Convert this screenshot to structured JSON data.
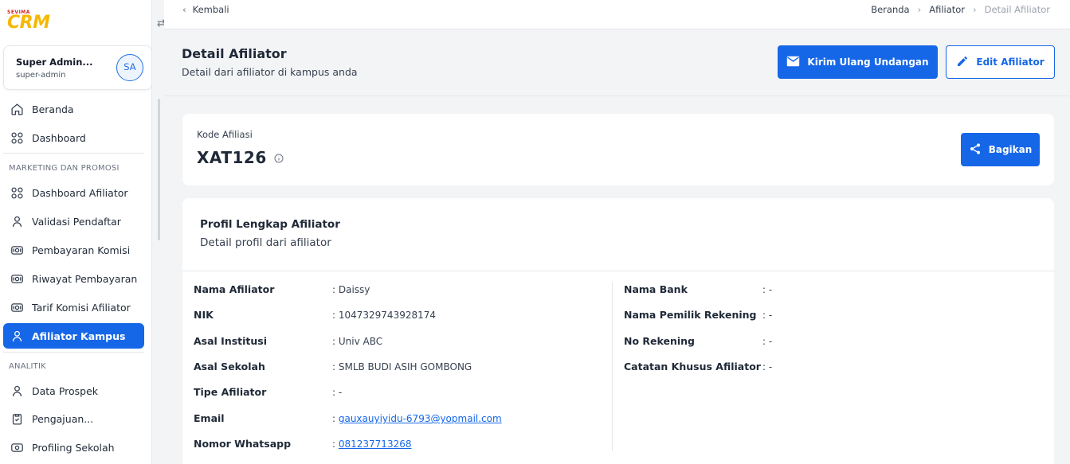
{
  "brand": {
    "top": "SEVIMA",
    "name": "CRM"
  },
  "user": {
    "name": "Super Admin...",
    "role": "super-admin",
    "initials": "SA"
  },
  "nav": {
    "main": [
      {
        "label": "Beranda",
        "icon": "home-icon"
      },
      {
        "label": "Dashboard",
        "icon": "grid-icon"
      }
    ],
    "section1": "MARKETING DAN PROMOSI",
    "marketing": [
      {
        "label": "Dashboard Afiliator",
        "icon": "grid-icon"
      },
      {
        "label": "Validasi Pendaftar",
        "icon": "person-icon"
      },
      {
        "label": "Pembayaran Komisi",
        "icon": "money-icon"
      },
      {
        "label": "Riwayat Pembayaran",
        "icon": "money-icon"
      },
      {
        "label": "Tarif Komisi Afiliator",
        "icon": "money-icon"
      },
      {
        "label": "Afiliator Kampus",
        "icon": "person-icon",
        "active": true
      }
    ],
    "section2": "ANALITIK",
    "analitik": [
      {
        "label": "Data Prospek",
        "icon": "person-icon"
      },
      {
        "label": "Pengajuan...",
        "icon": "clipboard-icon"
      },
      {
        "label": "Profiling Sekolah",
        "icon": "money-icon"
      }
    ]
  },
  "topbar": {
    "back": "Kembali",
    "breadcrumb": [
      "Beranda",
      "Afiliator",
      "Detail Afiliator"
    ]
  },
  "header": {
    "title": "Detail Afiliator",
    "subtitle": "Detail dari afiliator di kampus anda",
    "resend_label": "Kirim Ulang Undangan",
    "edit_label": "Edit Afiliator"
  },
  "code_card": {
    "label": "Kode Afiliasi",
    "value": "XAT126",
    "share_label": "Bagikan"
  },
  "profile": {
    "title": "Profil Lengkap Afiliator",
    "subtitle": "Detail profil dari afiliator",
    "left": [
      {
        "label": "Nama Afiliator",
        "value": ": Daissy"
      },
      {
        "label": "NIK",
        "value": ": 1047329743928174"
      },
      {
        "label": "Asal Institusi",
        "value": ": Univ ABC"
      },
      {
        "label": "Asal Sekolah",
        "value": ": SMLB BUDI ASIH GOMBONG"
      },
      {
        "label": "Tipe Afiliator",
        "value": ": -"
      },
      {
        "label": "Email",
        "value": "gauxauyiyidu-6793@yopmail.com"
      },
      {
        "label": "Nomor Whatsapp",
        "value": "081237713268"
      }
    ],
    "right": [
      {
        "label": "Nama Bank",
        "value": ": -"
      },
      {
        "label": "Nama Pemilik Rekening",
        "value": ": -"
      },
      {
        "label": "No Rekening",
        "value": ": -"
      },
      {
        "label": "Catatan Khusus Afiliator",
        "value": ": -"
      }
    ]
  },
  "colors": {
    "primary": "#1667e8",
    "brand_yellow": "#f5b800",
    "brand_red": "#d92020"
  }
}
